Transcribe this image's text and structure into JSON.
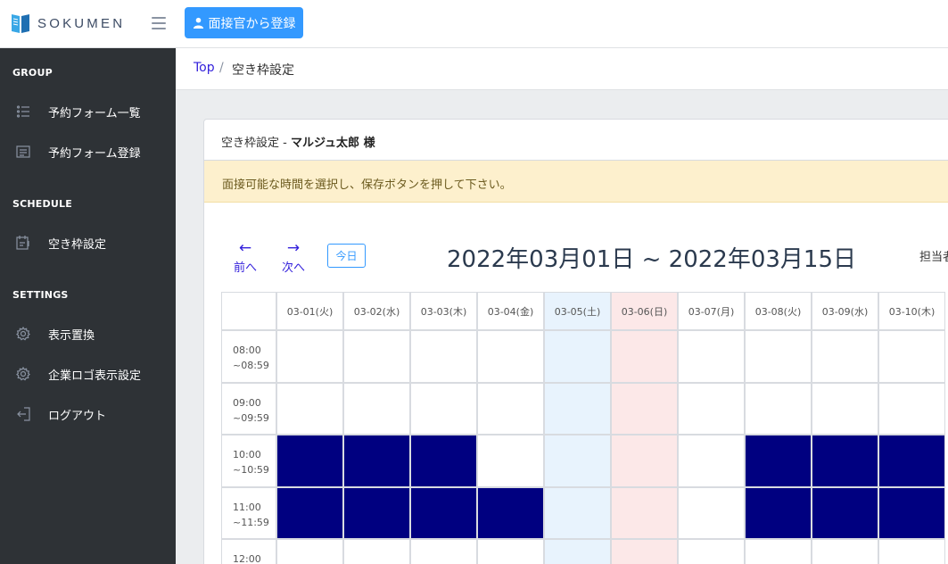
{
  "app": {
    "logo_text": "SOKUMEN",
    "register_button": "面接官から登録"
  },
  "sidebar": {
    "sections": [
      {
        "title": "GROUP",
        "items": [
          {
            "label": "予約フォーム一覧",
            "icon": "list-icon"
          },
          {
            "label": "予約フォーム登録",
            "icon": "form-icon"
          }
        ]
      },
      {
        "title": "SCHEDULE",
        "items": [
          {
            "label": "空き枠設定",
            "icon": "calendar-icon"
          }
        ]
      },
      {
        "title": "SETTINGS",
        "items": [
          {
            "label": "表示置換",
            "icon": "gear-icon"
          },
          {
            "label": "企業ロゴ表示設定",
            "icon": "gear-icon"
          },
          {
            "label": "ログアウト",
            "icon": "logout-icon"
          }
        ]
      }
    ]
  },
  "breadcrumb": {
    "top": "Top",
    "separator": "/",
    "current": "空き枠設定"
  },
  "card": {
    "title_prefix": "空き枠設定 - ",
    "title_name": "マルジュ太郎 様",
    "alert": "面接可能な時間を選択し、保存ボタンを押して下さい。"
  },
  "calendar": {
    "prev_label": "前へ",
    "next_label": "次へ",
    "prev_arrow": "←",
    "next_arrow": "→",
    "today_label": "今日",
    "range_title": "2022年03月01日 ~ 2022年03月15日",
    "staff_label": "担当者",
    "days": [
      {
        "label": "03-01(火)",
        "type": "weekday"
      },
      {
        "label": "03-02(水)",
        "type": "weekday"
      },
      {
        "label": "03-03(木)",
        "type": "weekday"
      },
      {
        "label": "03-04(金)",
        "type": "weekday"
      },
      {
        "label": "03-05(土)",
        "type": "saturday"
      },
      {
        "label": "03-06(日)",
        "type": "sunday"
      },
      {
        "label": "03-07(月)",
        "type": "weekday"
      },
      {
        "label": "03-08(火)",
        "type": "weekday"
      },
      {
        "label": "03-09(水)",
        "type": "weekday"
      },
      {
        "label": "03-10(木)",
        "type": "weekday"
      }
    ],
    "time_slots": [
      {
        "start": "08:00",
        "end": "~08:59"
      },
      {
        "start": "09:00",
        "end": "~09:59"
      },
      {
        "start": "10:00",
        "end": "~10:59"
      },
      {
        "start": "11:00",
        "end": "~11:59"
      },
      {
        "start": "12:00",
        "end": ""
      }
    ],
    "selected": [
      [
        false,
        false,
        false,
        false,
        false,
        false,
        false,
        false,
        false,
        false
      ],
      [
        false,
        false,
        false,
        false,
        false,
        false,
        false,
        false,
        false,
        false
      ],
      [
        true,
        true,
        true,
        false,
        false,
        false,
        false,
        true,
        true,
        true
      ],
      [
        true,
        true,
        true,
        true,
        false,
        false,
        false,
        true,
        true,
        true
      ],
      [
        false,
        false,
        false,
        false,
        false,
        false,
        false,
        false,
        false,
        false
      ]
    ]
  },
  "colors": {
    "selected": "#000080",
    "saturday": "#e8f3fd",
    "sunday": "#fce8e8",
    "weekday": "#ffffff",
    "accent": "#3399ff",
    "link": "#321fdb",
    "sidebar_bg": "#2e3236"
  }
}
